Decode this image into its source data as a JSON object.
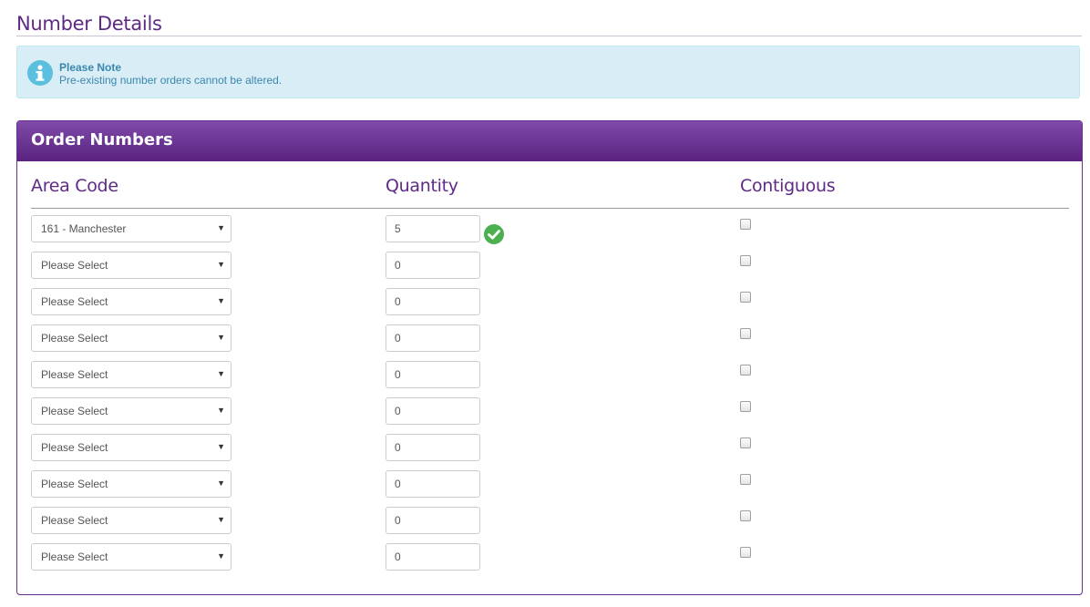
{
  "page": {
    "title": "Number Details"
  },
  "note": {
    "title": "Please Note",
    "text": "Pre-existing number orders cannot be altered.",
    "icon": "info-icon"
  },
  "panel": {
    "title": "Order Numbers"
  },
  "columns": {
    "area_code": "Area Code",
    "quantity": "Quantity",
    "contiguous": "Contiguous"
  },
  "rows": [
    {
      "area_code": "161 - Manchester",
      "quantity": "5",
      "contiguous": false,
      "valid": true
    },
    {
      "area_code": "Please Select",
      "quantity": "0",
      "contiguous": false,
      "valid": false
    },
    {
      "area_code": "Please Select",
      "quantity": "0",
      "contiguous": false,
      "valid": false
    },
    {
      "area_code": "Please Select",
      "quantity": "0",
      "contiguous": false,
      "valid": false
    },
    {
      "area_code": "Please Select",
      "quantity": "0",
      "contiguous": false,
      "valid": false
    },
    {
      "area_code": "Please Select",
      "quantity": "0",
      "contiguous": false,
      "valid": false
    },
    {
      "area_code": "Please Select",
      "quantity": "0",
      "contiguous": false,
      "valid": false
    },
    {
      "area_code": "Please Select",
      "quantity": "0",
      "contiguous": false,
      "valid": false
    },
    {
      "area_code": "Please Select",
      "quantity": "0",
      "contiguous": false,
      "valid": false
    },
    {
      "area_code": "Please Select",
      "quantity": "0",
      "contiguous": false,
      "valid": false
    }
  ],
  "colors": {
    "brand_purple": "#5e2a85",
    "info_bg": "#d9edf7",
    "info_text": "#3a87ad",
    "success_green": "#4caf50"
  }
}
